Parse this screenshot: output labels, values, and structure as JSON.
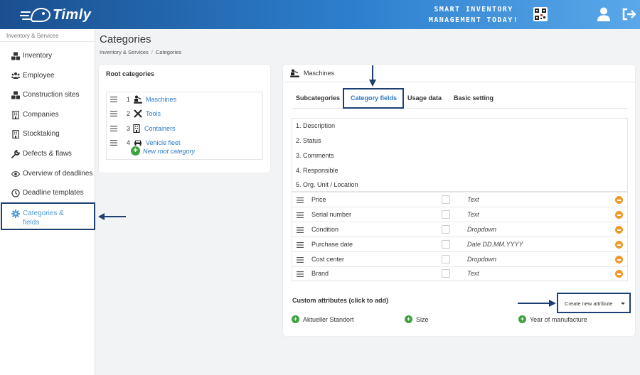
{
  "header": {
    "logo_text": "Timly",
    "slogan_line1": "SMART INVENTORY",
    "slogan_line2": "MANAGEMENT TODAY!"
  },
  "sidebar": {
    "section_title": "Inventory & Services",
    "items": [
      {
        "label": "Inventory",
        "icon": "cubes-icon"
      },
      {
        "label": "Employee",
        "icon": "users-icon"
      },
      {
        "label": "Construction sites",
        "icon": "cubes-icon"
      },
      {
        "label": "Companies",
        "icon": "building-icon"
      },
      {
        "label": "Stocktaking",
        "icon": "building-icon"
      },
      {
        "label": "Defects & flaws",
        "icon": "wrench-icon"
      },
      {
        "label": "Overview of deadlines",
        "icon": "eye-icon"
      },
      {
        "label": "Deadline templates",
        "icon": "clock-icon"
      },
      {
        "label_line1": "Categories &",
        "label_line2": "fields",
        "icon": "gear-icon",
        "active": true
      }
    ]
  },
  "page": {
    "title": "Categories",
    "breadcrumb": [
      "Inventory & Services",
      "Categories"
    ]
  },
  "root_categories": {
    "title": "Root categories",
    "items": [
      {
        "num": "1",
        "label": "Maschines",
        "icon": "machine-icon"
      },
      {
        "num": "2",
        "label": "Tools",
        "icon": "tools-icon"
      },
      {
        "num": "3",
        "label": "Containers",
        "icon": "building-icon"
      },
      {
        "num": "4",
        "label": "Vehicle fleet",
        "icon": "car-icon"
      }
    ],
    "new_label": "New root category"
  },
  "category_panel": {
    "title": "Maschines",
    "tabs": [
      {
        "label": "Subcategories"
      },
      {
        "label": "Category fields",
        "active": true
      },
      {
        "label": "Usage data"
      },
      {
        "label": "Basic setting"
      }
    ],
    "standard_fields": [
      "1. Description",
      "2. Status",
      "3. Comments",
      "4. Responsible",
      "5. Org. Unit / Location"
    ],
    "custom_fields": [
      {
        "name": "Price",
        "type": "Text"
      },
      {
        "name": "Serial number",
        "type": "Text"
      },
      {
        "name": "Condition",
        "type": "Dropdown"
      },
      {
        "name": "Purchase date",
        "type": "Date DD.MM.YYYY"
      },
      {
        "name": "Cost center",
        "type": "Dropdown"
      },
      {
        "name": "Brand",
        "type": "Text"
      }
    ],
    "custom_attributes_title": "Custom attributes (click to add)",
    "create_attribute_label": "Create new attribute",
    "attributes": [
      "Aktueller Standort",
      "Size",
      "Year of manufacture"
    ]
  },
  "colors": {
    "accent": "#2a79c4",
    "highlight_border": "#1d3f73",
    "add_green": "#3ba33b",
    "remove_orange": "#ef9a2b"
  }
}
